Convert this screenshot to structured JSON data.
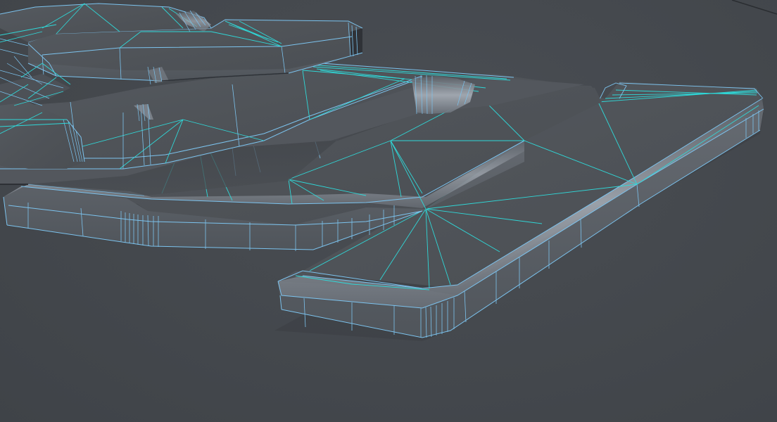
{
  "viewport": {
    "view": "perspective",
    "shading": "smooth-with-wireframe",
    "colors": {
      "background": "#44484d",
      "top_face": "#4f5358",
      "top_face_light": "#5b6067",
      "side_face": "#585d63",
      "side_face_dark": "#3a3d42",
      "bevel_highlight": "#9aa1aa",
      "edge_wire": "#7cc3ee",
      "triangle_wire": "#2fd8d8",
      "shadow": "#303338"
    },
    "objects": [
      {
        "name": "bevelled-extruded-mesh",
        "kind": "mesh"
      }
    ]
  }
}
